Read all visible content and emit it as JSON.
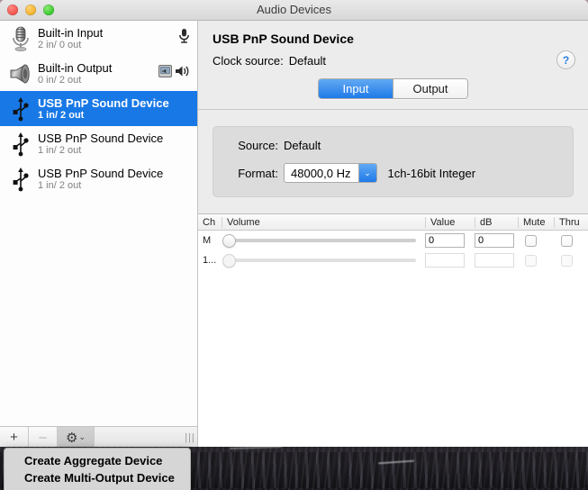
{
  "window": {
    "title": "Audio Devices",
    "traffic_lights": [
      "close-button",
      "minimize-button",
      "zoom-button"
    ]
  },
  "sidebar": {
    "devices": [
      {
        "name": "Built-in Input",
        "channels": "2 in/ 0 out",
        "icon": "microphone-icon",
        "selected": false,
        "badges": [
          "default-input-mic-icon"
        ]
      },
      {
        "name": "Built-in Output",
        "channels": "0 in/ 2 out",
        "icon": "speaker-icon",
        "selected": false,
        "badges": [
          "system-sound-output-icon",
          "default-output-speaker-icon"
        ]
      },
      {
        "name": "USB PnP Sound Device",
        "channels": "1 in/ 2 out",
        "icon": "usb-icon",
        "selected": true,
        "badges": []
      },
      {
        "name": "USB PnP Sound Device",
        "channels": "1 in/ 2 out",
        "icon": "usb-icon",
        "selected": false,
        "badges": []
      },
      {
        "name": "USB PnP Sound Device",
        "channels": "1 in/ 2 out",
        "icon": "usb-icon",
        "selected": false,
        "badges": []
      }
    ],
    "toolbar": {
      "add_label": "+",
      "remove_label": "–",
      "gear_label": "⚙",
      "gear_arrow": "⌄",
      "grip_label": "|||"
    }
  },
  "menu": {
    "items": [
      "Create Aggregate Device",
      "Create Multi-Output Device"
    ]
  },
  "pane": {
    "device_title": "USB PnP Sound Device",
    "clock_label": "Clock source:",
    "clock_value": "Default",
    "help_label": "?",
    "tabs": [
      {
        "label": "Input",
        "active": true
      },
      {
        "label": "Output",
        "active": false
      }
    ],
    "format_box": {
      "source_label": "Source:",
      "source_value": "Default",
      "format_label": "Format:",
      "format_value": "48000,0 Hz",
      "format_arrow": "⌄",
      "format_description": "1ch-16bit Integer"
    },
    "table": {
      "columns": [
        "Ch",
        "Volume",
        "Value",
        "dB",
        "Mute",
        "Thru"
      ],
      "rows": [
        {
          "ch": "M",
          "volume": 0,
          "value": "0",
          "db": "0",
          "mute": false,
          "thru": false,
          "enabled": true
        },
        {
          "ch": "1...",
          "volume": 0,
          "value": "",
          "db": "",
          "mute": false,
          "thru": false,
          "enabled": false
        }
      ]
    }
  },
  "colors": {
    "selection_blue": "#1878e6",
    "accent_blue": "#2f7fe0",
    "window_bg": "#ececec",
    "sidebar_bg": "#fdfdfd",
    "format_box_bg": "#dcdcdc"
  }
}
